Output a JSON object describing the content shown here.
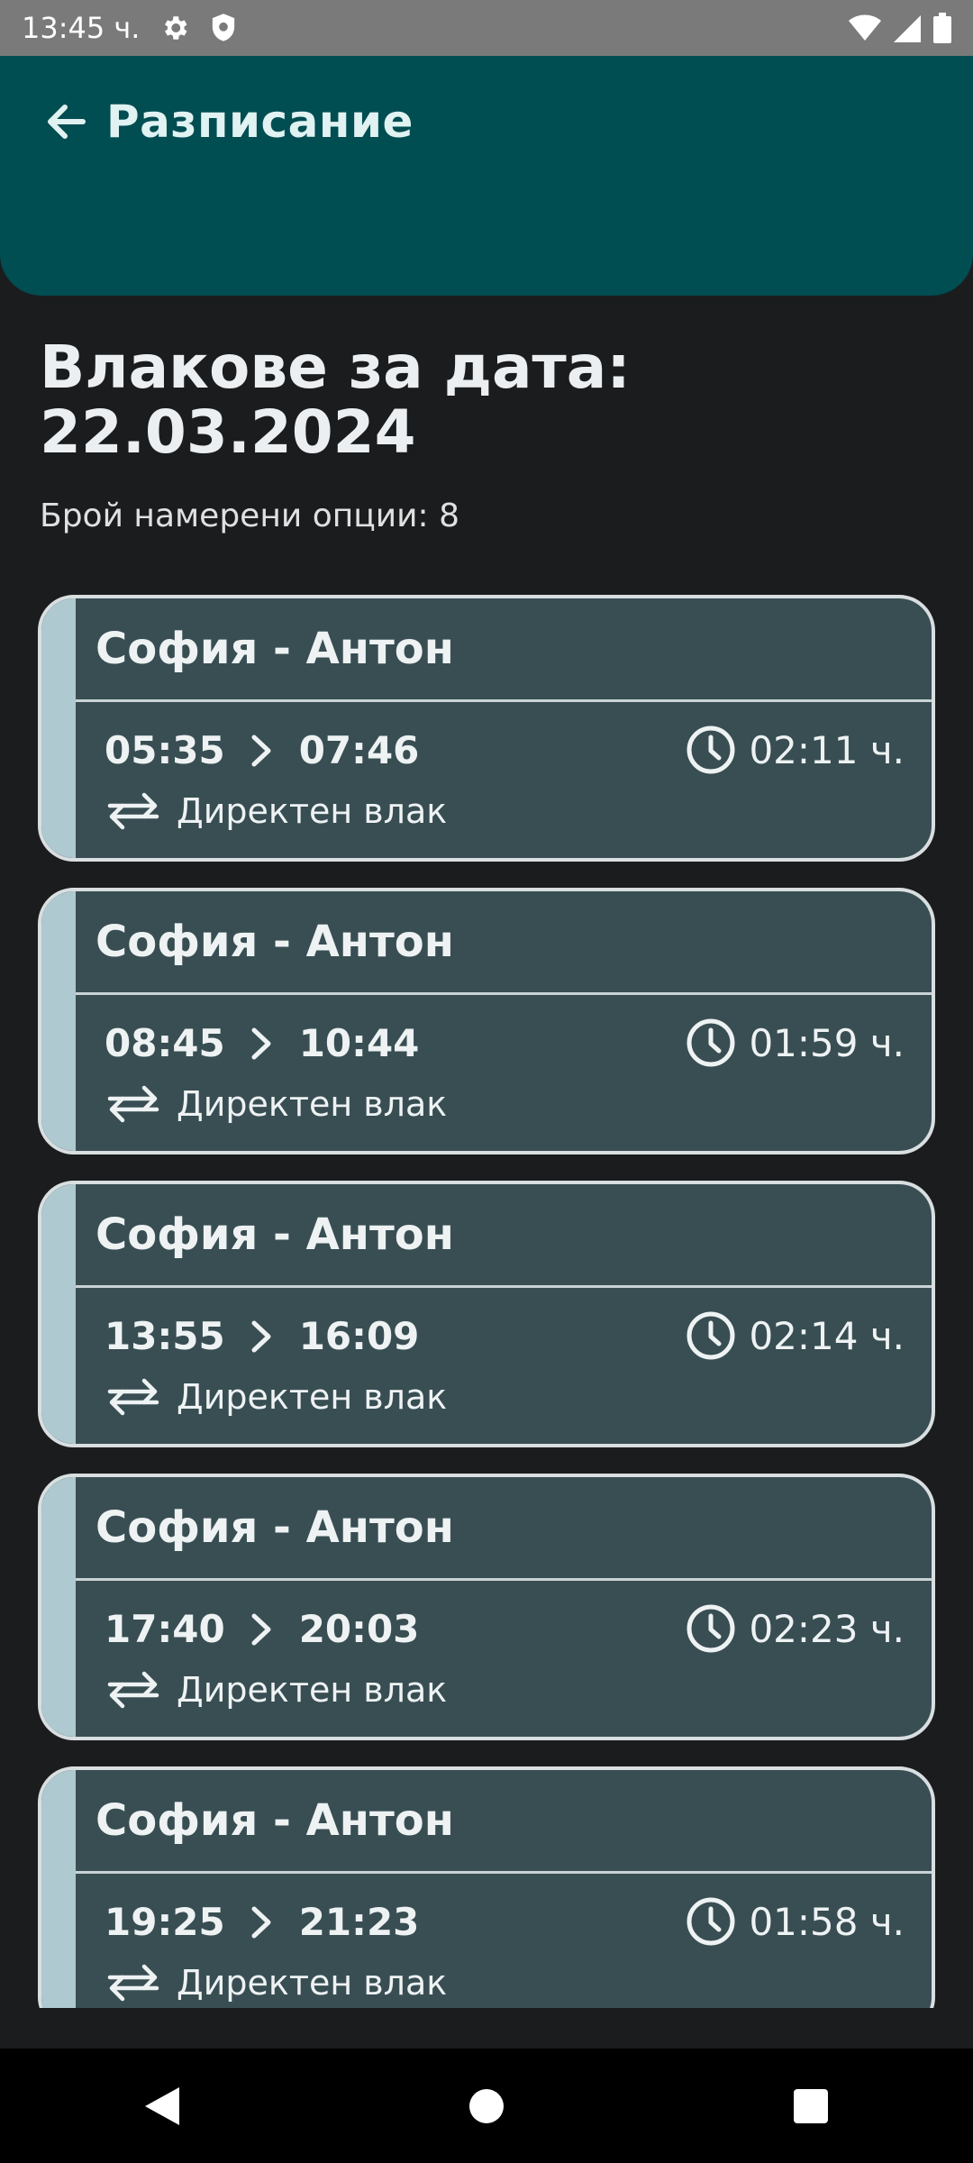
{
  "status_bar": {
    "time": "13:45 ч."
  },
  "header": {
    "title": "Разписание"
  },
  "page": {
    "title": "Влакове за дата: 22.03.2024",
    "result_count": "Брой намерени опции: 8"
  },
  "trains": [
    {
      "route": "София - Антон",
      "departure": "05:35",
      "arrival": "07:46",
      "duration": "02:11 ч.",
      "type": "Директен влак"
    },
    {
      "route": "София - Антон",
      "departure": "08:45",
      "arrival": "10:44",
      "duration": "01:59 ч.",
      "type": "Директен влак"
    },
    {
      "route": "София - Антон",
      "departure": "13:55",
      "arrival": "16:09",
      "duration": "02:14 ч.",
      "type": "Директен влак"
    },
    {
      "route": "София - Антон",
      "departure": "17:40",
      "arrival": "20:03",
      "duration": "02:23 ч.",
      "type": "Директен влак"
    },
    {
      "route": "София - Антон",
      "departure": "19:25",
      "arrival": "21:23",
      "duration": "01:58 ч.",
      "type": "Директен влак"
    }
  ],
  "icons": {
    "back": "arrow-left-icon",
    "settings": "gear-icon",
    "shield": "shield-icon",
    "wifi": "wifi-icon",
    "signal": "signal-icon",
    "battery": "battery-icon",
    "chevron": "chevron-right-icon",
    "clock": "clock-icon",
    "transfer": "swap-arrows-icon",
    "nav_back": "triangle-back-icon",
    "nav_home": "circle-home-icon",
    "nav_recents": "square-recents-icon"
  },
  "colors": {
    "header_bg": "#004d52",
    "card_bg": "#384e53",
    "card_stripe": "#aec9cf",
    "page_bg": "#1b1c1e"
  }
}
